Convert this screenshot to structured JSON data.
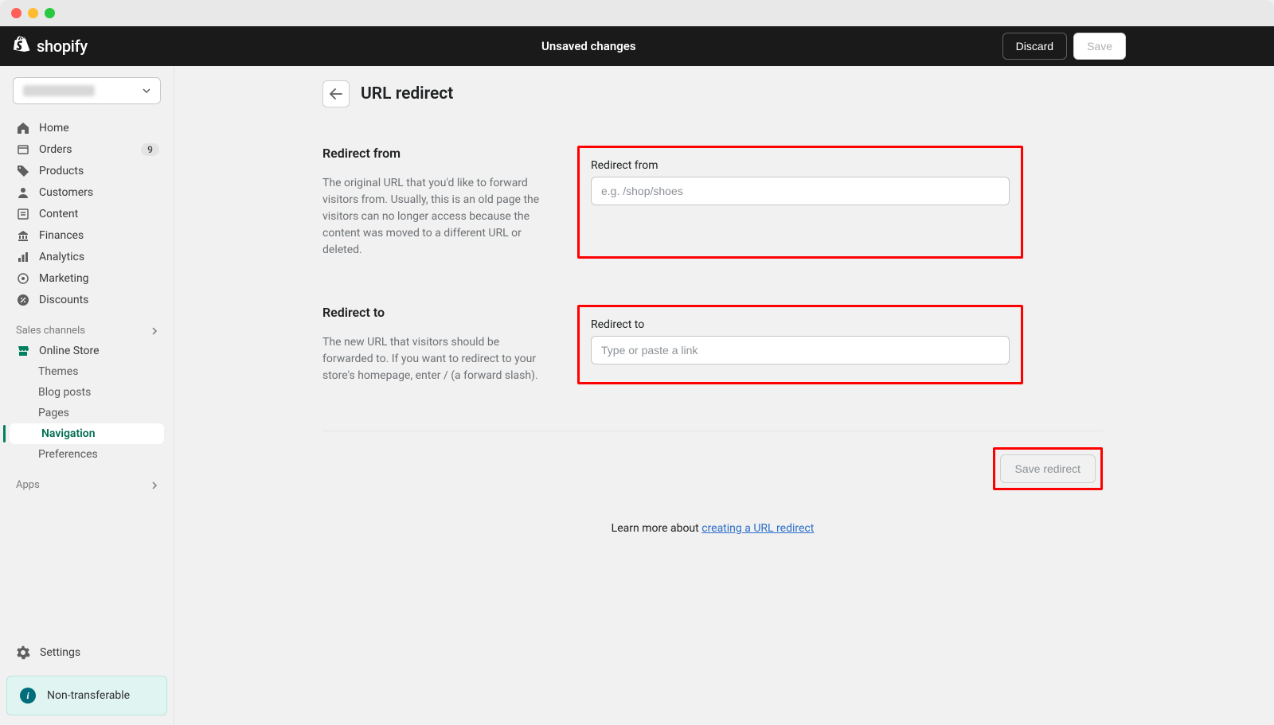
{
  "brand": "shopify",
  "topbar": {
    "unsaved_label": "Unsaved changes",
    "discard_label": "Discard",
    "save_label": "Save"
  },
  "sidebar": {
    "items": [
      {
        "icon": "home-icon",
        "label": "Home"
      },
      {
        "icon": "orders-icon",
        "label": "Orders",
        "badge": "9"
      },
      {
        "icon": "products-icon",
        "label": "Products"
      },
      {
        "icon": "customers-icon",
        "label": "Customers"
      },
      {
        "icon": "content-icon",
        "label": "Content"
      },
      {
        "icon": "finances-icon",
        "label": "Finances"
      },
      {
        "icon": "analytics-icon",
        "label": "Analytics"
      },
      {
        "icon": "marketing-icon",
        "label": "Marketing"
      },
      {
        "icon": "discounts-icon",
        "label": "Discounts"
      }
    ],
    "sales_channels_label": "Sales channels",
    "online_store_label": "Online Store",
    "online_store_subs": [
      {
        "label": "Themes"
      },
      {
        "label": "Blog posts"
      },
      {
        "label": "Pages"
      },
      {
        "label": "Navigation",
        "active": true
      },
      {
        "label": "Preferences"
      }
    ],
    "apps_label": "Apps",
    "settings_label": "Settings",
    "info_box": "Non-transferable"
  },
  "page": {
    "title": "URL redirect",
    "section_from": {
      "heading": "Redirect from",
      "desc": "The original URL that you'd like to forward visitors from. Usually, this is an old page the visitors can no longer access because the content was moved to a different URL or deleted.",
      "label": "Redirect from",
      "placeholder": "e.g. /shop/shoes"
    },
    "section_to": {
      "heading": "Redirect to",
      "desc": "The new URL that visitors should be forwarded to. If you want to redirect to your store's homepage, enter / (a forward slash).",
      "label": "Redirect to",
      "placeholder": "Type or paste a link"
    },
    "save_redirect_label": "Save redirect",
    "learn_more_prefix": "Learn more about ",
    "learn_more_link": "creating a URL redirect"
  }
}
